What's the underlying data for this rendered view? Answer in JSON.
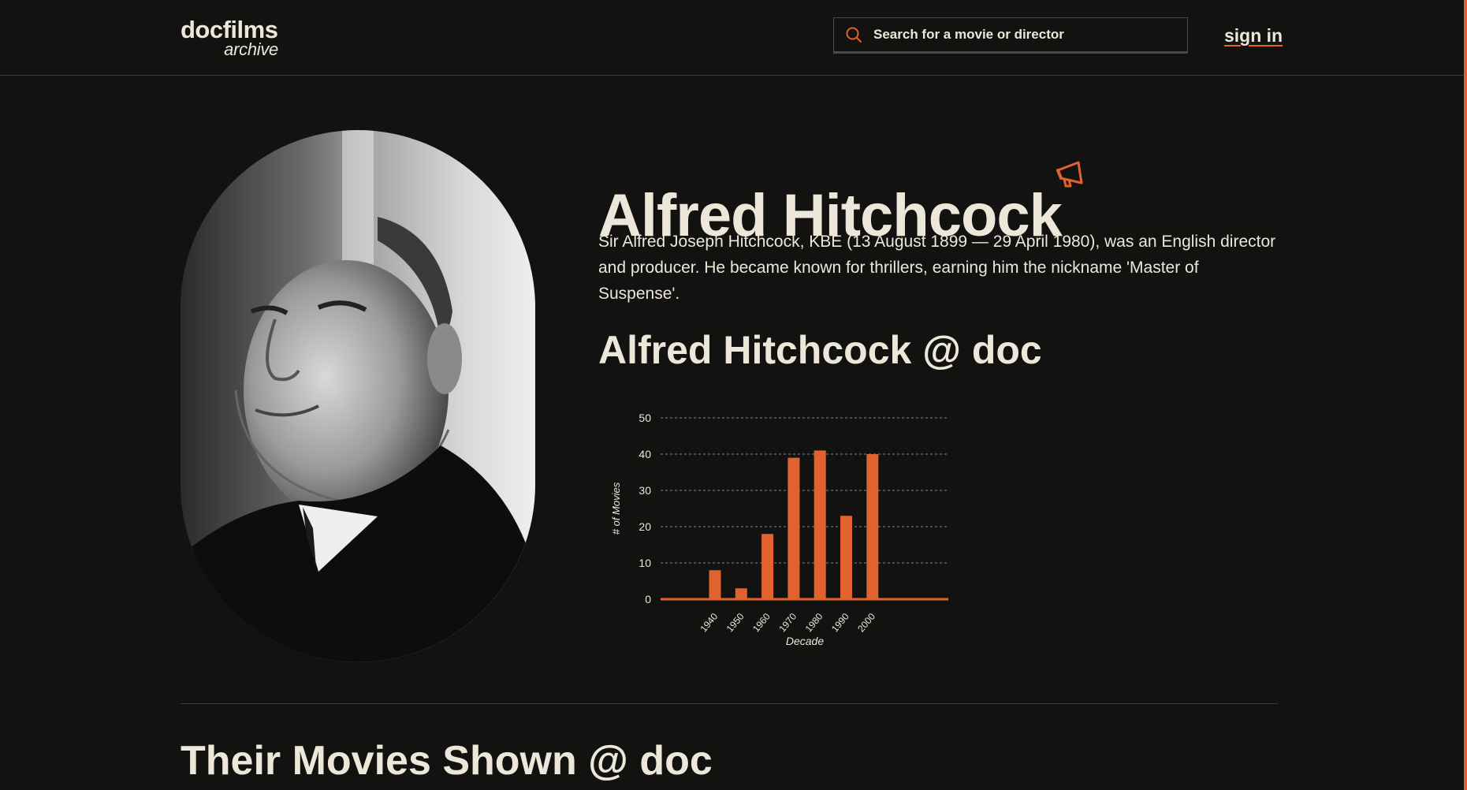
{
  "header": {
    "logo_line1": "docfilms",
    "logo_line2": "archive",
    "search_placeholder": "Search for a movie or director",
    "signin_label": "sign in"
  },
  "director": {
    "name": "Alfred Hitchcock",
    "bio": "Sir Alfred Joseph Hitchcock, KBE (13 August 1899 — 29 April 1980), was an English director and producer. He became known for thrillers, earning him the nickname 'Master of Suspense'.",
    "stats_title": "Alfred Hitchcock @ doc"
  },
  "movies_section": {
    "title": "Their Movies Shown @ doc"
  },
  "colors": {
    "accent": "#e0622f",
    "background": "#121211",
    "text": "#ece7d9"
  },
  "icons": {
    "search": "search-icon",
    "director": "megaphone-icon"
  },
  "chart_data": {
    "type": "bar",
    "categories": [
      "1940",
      "1950",
      "1960",
      "1970",
      "1980",
      "1990",
      "2000"
    ],
    "values": [
      8,
      3,
      18,
      39,
      41,
      23,
      40
    ],
    "xlabel": "Decade",
    "ylabel": "# of Movies",
    "ylim": [
      0,
      50
    ],
    "yticks": [
      0,
      10,
      20,
      30,
      40,
      50
    ],
    "grid": true,
    "color": "#e0622f"
  }
}
